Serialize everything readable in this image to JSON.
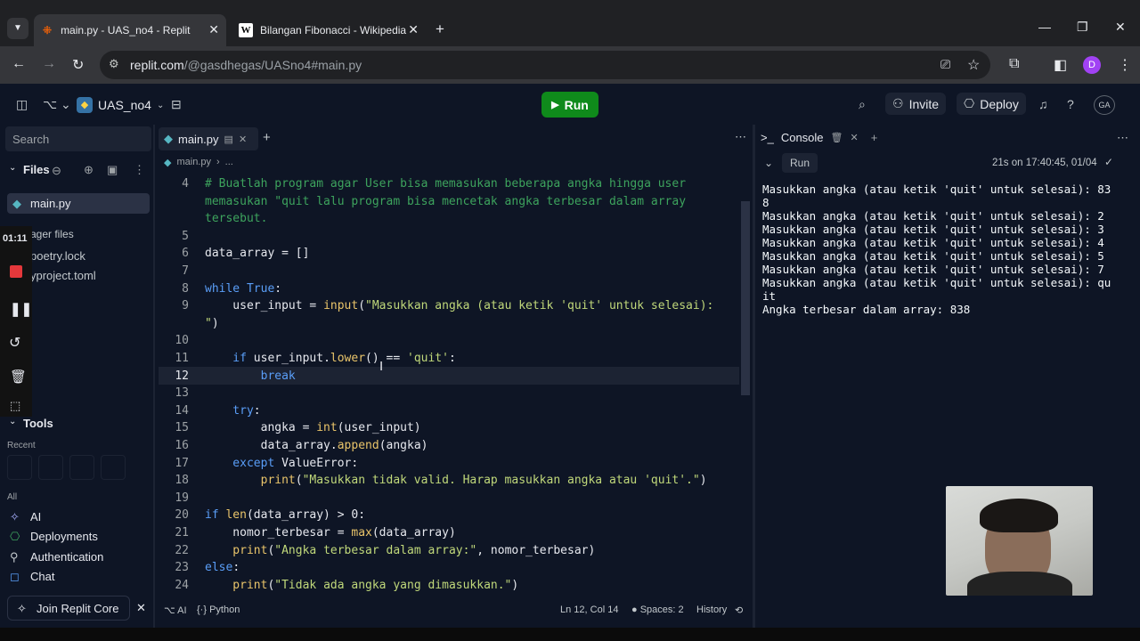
{
  "browser": {
    "tabs": [
      {
        "label": "main.py - UAS_no4 - Replit",
        "active": true
      },
      {
        "label": "Bilangan Fibonacci - Wikipedia",
        "active": false
      }
    ],
    "url_host": "replit.com",
    "url_path": "/@gasdhegas/UASno4#main.py",
    "profile_initial": "D"
  },
  "replit": {
    "repl_name": "UAS_no4",
    "run_label": "Run",
    "invite_label": "Invite",
    "deploy_label": "Deploy",
    "avatar_initials": "GA"
  },
  "sidebar": {
    "search_placeholder": "Search",
    "files_label": "Files",
    "files": [
      "main.py",
      "ager files",
      "poetry.lock",
      "yproject.toml"
    ],
    "timer": "01:11",
    "tools_label": "Tools",
    "recent_label": "Recent",
    "all_label": "All",
    "tools": [
      "AI",
      "Deployments",
      "Authentication",
      "Chat"
    ],
    "join_label": "Join Replit Core"
  },
  "editor": {
    "tab_label": "main.py",
    "breadcrumb_file": "main.py",
    "breadcrumb_more": "...",
    "line_numbers": [
      "4",
      "",
      "",
      "5",
      "6",
      "7",
      "8",
      "9",
      "",
      "10",
      "11",
      "12",
      "13",
      "14",
      "15",
      "16",
      "17",
      "18",
      "19",
      "20",
      "21",
      "22",
      "23",
      "24"
    ],
    "status": {
      "ai": "AI",
      "language": "Python",
      "position": "Ln 12, Col 14",
      "spaces": "Spaces: 2",
      "history": "History"
    }
  },
  "console": {
    "tab_label": "Console",
    "run_label": "Run",
    "run_info": "21s on 17:40:45, 01/04",
    "lines": [
      "Masukkan angka (atau ketik 'quit' untuk selesai): 83",
      "8",
      "Masukkan angka (atau ketik 'quit' untuk selesai): 2",
      "Masukkan angka (atau ketik 'quit' untuk selesai): 3",
      "Masukkan angka (atau ketik 'quit' untuk selesai): 4",
      "Masukkan angka (atau ketik 'quit' untuk selesai): 5",
      "Masukkan angka (atau ketik 'quit' untuk selesai): 7",
      "Masukkan angka (atau ketik 'quit' untuk selesai): qu",
      "it",
      "Angka terbesar dalam array: 838"
    ]
  },
  "code_lines": [
    [
      [
        "cm",
        "# Buatlah program agar User bisa memasukan beberapa angka hingga user"
      ]
    ],
    [
      [
        "cm",
        "memasukan \"quit lalu program bisa mencetak angka terbesar dalam array"
      ]
    ],
    [
      [
        "cm",
        "tersebut."
      ]
    ],
    [],
    [
      [
        "nm",
        "data_array = []"
      ]
    ],
    [],
    [
      [
        "kw",
        "while "
      ],
      [
        "kw",
        "True"
      ],
      [
        "nm",
        ":"
      ]
    ],
    [
      [
        "nm",
        "    user_input = "
      ],
      [
        "fn",
        "input"
      ],
      [
        "nm",
        "("
      ],
      [
        "st",
        "\"Masukkan angka (atau ketik 'quit' untuk selesai):"
      ]
    ],
    [
      [
        "st",
        "\""
      ],
      [
        "nm",
        ")"
      ]
    ],
    [],
    [
      [
        "kw",
        "    if "
      ],
      [
        "nm",
        "user_input."
      ],
      [
        "fn",
        "lower"
      ],
      [
        "nm",
        "() == "
      ],
      [
        "st",
        "'quit'"
      ],
      [
        "nm",
        ":"
      ]
    ],
    [
      [
        "kw",
        "        break"
      ]
    ],
    [],
    [
      [
        "kw",
        "    try"
      ],
      [
        "nm",
        ":"
      ]
    ],
    [
      [
        "nm",
        "        angka = "
      ],
      [
        "fn",
        "int"
      ],
      [
        "nm",
        "(user_input)"
      ]
    ],
    [
      [
        "nm",
        "        data_array."
      ],
      [
        "fn",
        "append"
      ],
      [
        "nm",
        "(angka)"
      ]
    ],
    [
      [
        "kw",
        "    except "
      ],
      [
        "nm",
        "ValueError:"
      ]
    ],
    [
      [
        "fn",
        "        print"
      ],
      [
        "nm",
        "("
      ],
      [
        "st",
        "\"Masukkan tidak valid. Harap masukkan angka atau 'quit'.\""
      ],
      [
        "nm",
        ")"
      ]
    ],
    [],
    [
      [
        "kw",
        "if "
      ],
      [
        "fn",
        "len"
      ],
      [
        "nm",
        "(data_array) > "
      ],
      [
        "nm",
        "0"
      ],
      [
        "nm",
        ":"
      ]
    ],
    [
      [
        "nm",
        "    nomor_terbesar = "
      ],
      [
        "fn",
        "max"
      ],
      [
        "nm",
        "(data_array)"
      ]
    ],
    [
      [
        "fn",
        "    print"
      ],
      [
        "nm",
        "("
      ],
      [
        "st",
        "\"Angka terbesar dalam array:\""
      ],
      [
        "nm",
        ", nomor_terbesar)"
      ]
    ],
    [
      [
        "kw",
        "else"
      ],
      [
        "nm",
        ":"
      ]
    ],
    [
      [
        "fn",
        "    print"
      ],
      [
        "nm",
        "("
      ],
      [
        "st",
        "\"Tidak ada angka yang dimasukkan.\""
      ],
      [
        "nm",
        ")"
      ]
    ]
  ],
  "colors": {
    "run_green": "#0f8a1b",
    "keyword": "#5a9ef8",
    "function": "#e9c46a",
    "string": "#c0d87a",
    "comment": "#3da35d"
  }
}
